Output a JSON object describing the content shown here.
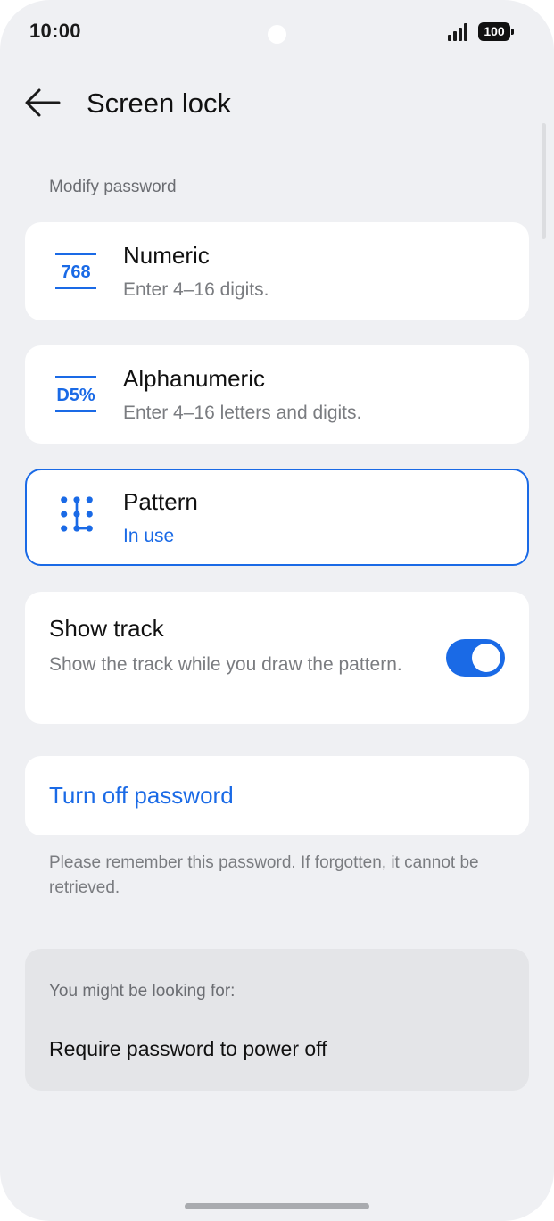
{
  "status_bar": {
    "time": "10:00",
    "battery": "100"
  },
  "header": {
    "title": "Screen lock",
    "back_icon": "arrow-left-icon"
  },
  "section_label": "Modify password",
  "options": [
    {
      "icon_text": "768",
      "title": "Numeric",
      "subtitle": "Enter 4–16 digits."
    },
    {
      "icon_text": "D5%",
      "title": "Alphanumeric",
      "subtitle": "Enter 4–16 letters and digits."
    },
    {
      "title": "Pattern",
      "subtitle": "In use",
      "selected": true
    }
  ],
  "show_track": {
    "title": "Show track",
    "description": "Show the track while you draw the pattern.",
    "enabled": true
  },
  "turn_off_label": "Turn off password",
  "note": "Please remember this password. If forgotten, it cannot be retrieved.",
  "suggestions": {
    "label": "You might be looking for:",
    "items": [
      "Require password to power off"
    ]
  },
  "colors": {
    "accent": "#1a6ae6",
    "background": "#eff0f3",
    "card": "#ffffff"
  }
}
